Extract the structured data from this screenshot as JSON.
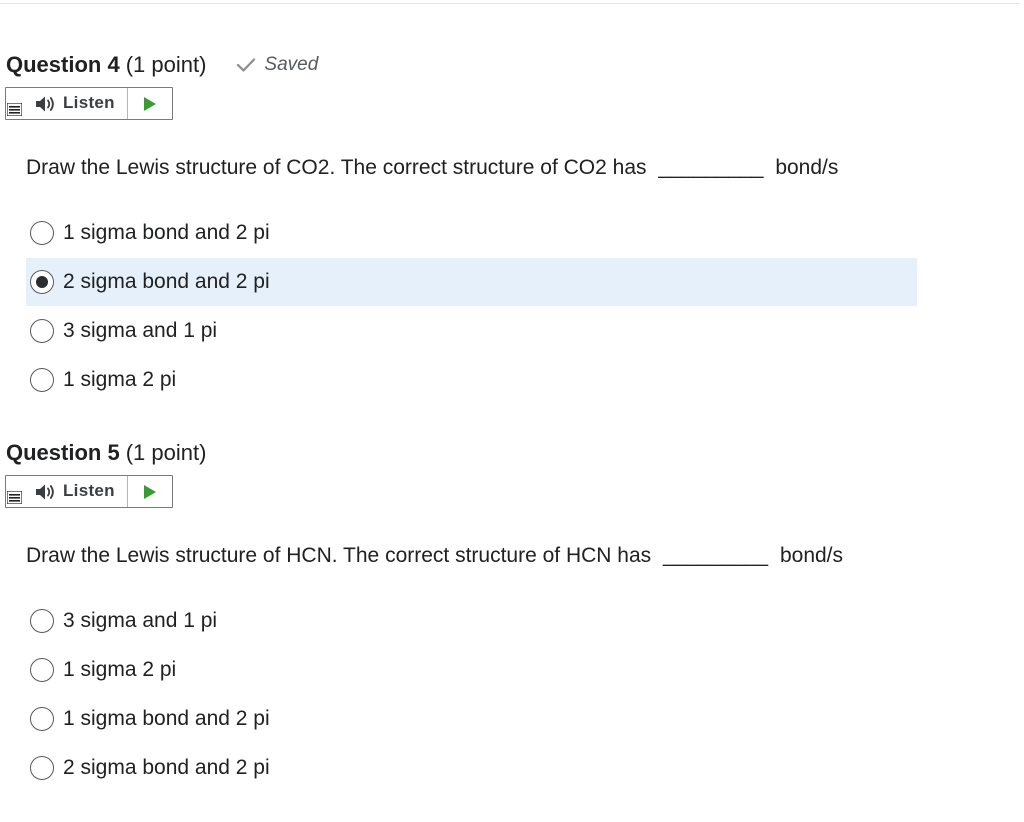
{
  "questions": [
    {
      "title": "Question 4",
      "points": "(1 point)",
      "saved_label": "Saved",
      "listen_label": "Listen",
      "prompt_before": "Draw the Lewis structure of CO2. The correct structure of CO2 has",
      "blank": "_________",
      "prompt_after": "bond/s",
      "options": [
        {
          "label": "1 sigma bond and 2 pi",
          "selected": false
        },
        {
          "label": "2 sigma bond and 2 pi",
          "selected": true
        },
        {
          "label": "3 sigma and 1 pi",
          "selected": false
        },
        {
          "label": "1 sigma 2 pi",
          "selected": false
        }
      ]
    },
    {
      "title": "Question 5",
      "points": "(1 point)",
      "listen_label": "Listen",
      "prompt_before": "Draw the Lewis structure of HCN. The correct structure of HCN has",
      "blank": "_________",
      "prompt_after": "bond/s",
      "options": [
        {
          "label": "3 sigma and 1 pi",
          "selected": false
        },
        {
          "label": "1 sigma 2 pi",
          "selected": false
        },
        {
          "label": "1 sigma bond and 2 pi",
          "selected": false
        },
        {
          "label": "2 sigma bond and 2 pi",
          "selected": false
        }
      ]
    }
  ],
  "icons": {
    "saved": "checkmark-icon",
    "listen": "speaker-icon",
    "menu": "menu-icon",
    "play": "play-icon"
  },
  "colors": {
    "selected_background": "#e6f0fb",
    "play_green": "#3a9b35",
    "text": "#202122",
    "muted": "#565a5c"
  }
}
